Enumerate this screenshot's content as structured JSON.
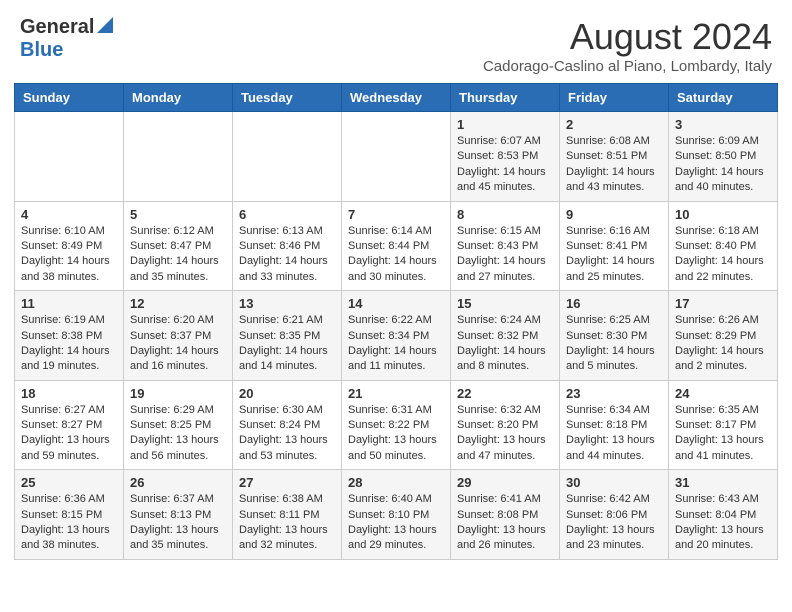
{
  "header": {
    "logo_general": "General",
    "logo_blue": "Blue",
    "month_year": "August 2024",
    "location": "Cadorago-Caslino al Piano, Lombardy, Italy"
  },
  "days_of_week": [
    "Sunday",
    "Monday",
    "Tuesday",
    "Wednesday",
    "Thursday",
    "Friday",
    "Saturday"
  ],
  "weeks": [
    [
      {
        "day": "",
        "info": ""
      },
      {
        "day": "",
        "info": ""
      },
      {
        "day": "",
        "info": ""
      },
      {
        "day": "",
        "info": ""
      },
      {
        "day": "1",
        "info": "Sunrise: 6:07 AM\nSunset: 8:53 PM\nDaylight: 14 hours and 45 minutes."
      },
      {
        "day": "2",
        "info": "Sunrise: 6:08 AM\nSunset: 8:51 PM\nDaylight: 14 hours and 43 minutes."
      },
      {
        "day": "3",
        "info": "Sunrise: 6:09 AM\nSunset: 8:50 PM\nDaylight: 14 hours and 40 minutes."
      }
    ],
    [
      {
        "day": "4",
        "info": "Sunrise: 6:10 AM\nSunset: 8:49 PM\nDaylight: 14 hours and 38 minutes."
      },
      {
        "day": "5",
        "info": "Sunrise: 6:12 AM\nSunset: 8:47 PM\nDaylight: 14 hours and 35 minutes."
      },
      {
        "day": "6",
        "info": "Sunrise: 6:13 AM\nSunset: 8:46 PM\nDaylight: 14 hours and 33 minutes."
      },
      {
        "day": "7",
        "info": "Sunrise: 6:14 AM\nSunset: 8:44 PM\nDaylight: 14 hours and 30 minutes."
      },
      {
        "day": "8",
        "info": "Sunrise: 6:15 AM\nSunset: 8:43 PM\nDaylight: 14 hours and 27 minutes."
      },
      {
        "day": "9",
        "info": "Sunrise: 6:16 AM\nSunset: 8:41 PM\nDaylight: 14 hours and 25 minutes."
      },
      {
        "day": "10",
        "info": "Sunrise: 6:18 AM\nSunset: 8:40 PM\nDaylight: 14 hours and 22 minutes."
      }
    ],
    [
      {
        "day": "11",
        "info": "Sunrise: 6:19 AM\nSunset: 8:38 PM\nDaylight: 14 hours and 19 minutes."
      },
      {
        "day": "12",
        "info": "Sunrise: 6:20 AM\nSunset: 8:37 PM\nDaylight: 14 hours and 16 minutes."
      },
      {
        "day": "13",
        "info": "Sunrise: 6:21 AM\nSunset: 8:35 PM\nDaylight: 14 hours and 14 minutes."
      },
      {
        "day": "14",
        "info": "Sunrise: 6:22 AM\nSunset: 8:34 PM\nDaylight: 14 hours and 11 minutes."
      },
      {
        "day": "15",
        "info": "Sunrise: 6:24 AM\nSunset: 8:32 PM\nDaylight: 14 hours and 8 minutes."
      },
      {
        "day": "16",
        "info": "Sunrise: 6:25 AM\nSunset: 8:30 PM\nDaylight: 14 hours and 5 minutes."
      },
      {
        "day": "17",
        "info": "Sunrise: 6:26 AM\nSunset: 8:29 PM\nDaylight: 14 hours and 2 minutes."
      }
    ],
    [
      {
        "day": "18",
        "info": "Sunrise: 6:27 AM\nSunset: 8:27 PM\nDaylight: 13 hours and 59 minutes."
      },
      {
        "day": "19",
        "info": "Sunrise: 6:29 AM\nSunset: 8:25 PM\nDaylight: 13 hours and 56 minutes."
      },
      {
        "day": "20",
        "info": "Sunrise: 6:30 AM\nSunset: 8:24 PM\nDaylight: 13 hours and 53 minutes."
      },
      {
        "day": "21",
        "info": "Sunrise: 6:31 AM\nSunset: 8:22 PM\nDaylight: 13 hours and 50 minutes."
      },
      {
        "day": "22",
        "info": "Sunrise: 6:32 AM\nSunset: 8:20 PM\nDaylight: 13 hours and 47 minutes."
      },
      {
        "day": "23",
        "info": "Sunrise: 6:34 AM\nSunset: 8:18 PM\nDaylight: 13 hours and 44 minutes."
      },
      {
        "day": "24",
        "info": "Sunrise: 6:35 AM\nSunset: 8:17 PM\nDaylight: 13 hours and 41 minutes."
      }
    ],
    [
      {
        "day": "25",
        "info": "Sunrise: 6:36 AM\nSunset: 8:15 PM\nDaylight: 13 hours and 38 minutes."
      },
      {
        "day": "26",
        "info": "Sunrise: 6:37 AM\nSunset: 8:13 PM\nDaylight: 13 hours and 35 minutes."
      },
      {
        "day": "27",
        "info": "Sunrise: 6:38 AM\nSunset: 8:11 PM\nDaylight: 13 hours and 32 minutes."
      },
      {
        "day": "28",
        "info": "Sunrise: 6:40 AM\nSunset: 8:10 PM\nDaylight: 13 hours and 29 minutes."
      },
      {
        "day": "29",
        "info": "Sunrise: 6:41 AM\nSunset: 8:08 PM\nDaylight: 13 hours and 26 minutes."
      },
      {
        "day": "30",
        "info": "Sunrise: 6:42 AM\nSunset: 8:06 PM\nDaylight: 13 hours and 23 minutes."
      },
      {
        "day": "31",
        "info": "Sunrise: 6:43 AM\nSunset: 8:04 PM\nDaylight: 13 hours and 20 minutes."
      }
    ]
  ]
}
